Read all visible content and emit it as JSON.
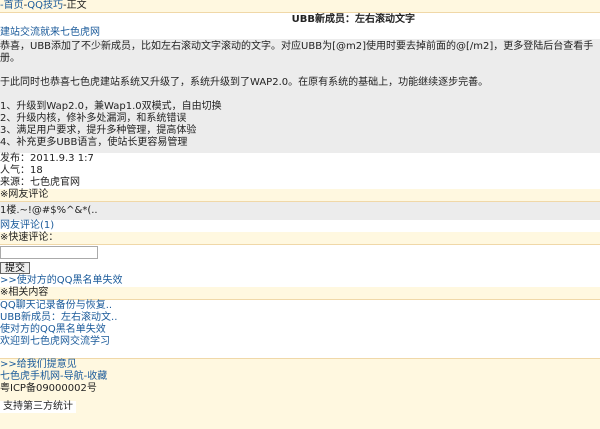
{
  "breadcrumb": {
    "home": "-首页",
    "sep1": "-",
    "category": "QQ技巧",
    "sep2": "-",
    "current": "正文"
  },
  "article": {
    "title": "UBB新成员：左右滚动文字",
    "site_link": "建站交流就来七色虎网",
    "paragraphs": [
      "恭喜，UBB添加了不少新成员，比如左右滚动文字滚动的文字。对应UBB为[@m2]使用时要去掉前面的@[/m2]，更多登陆后台查看手册。",
      "于此同时也恭喜七色虎建站系统又升级了，系统升级到了WAP2.0。在原有系统的基础上，功能继续逐步完善。"
    ],
    "list": [
      "1、升级到Wap2.0，兼Wap1.0双模式，自由切换",
      "2、升级内核，修补多处漏洞，和系统错误",
      "3、满足用户要求，提升多种管理，提高体验",
      "4、补充更多UBB语言，使站长更容易管理"
    ],
    "published": "发布：2011.9.3 1:7",
    "views": "人气：18",
    "source": "来源：七色虎官网"
  },
  "comments": {
    "header": "※网友评论",
    "items": [
      "1楼.~!@#$%^&*(.."
    ],
    "more_link": "网友评论(1)"
  },
  "quick_comment": {
    "header": "※快速评论：",
    "input_value": "",
    "submit": "提交",
    "next_link": ">>使对方的QQ黑名单失效"
  },
  "related": {
    "header": "※相关内容",
    "items": [
      "QQ聊天记录备份与恢复..",
      "UBB新成员：左右滚动文..",
      "使对方的QQ黑名单失效",
      "欢迎到七色虎网交流学习"
    ]
  },
  "footer": {
    "feedback": ">>给我们提意见",
    "site": "七色虎手机网",
    "nav": "导航",
    "fav": "收藏",
    "sep": "-",
    "icp": "粤ICP备09000002号",
    "stats": "支持第三方统计"
  }
}
